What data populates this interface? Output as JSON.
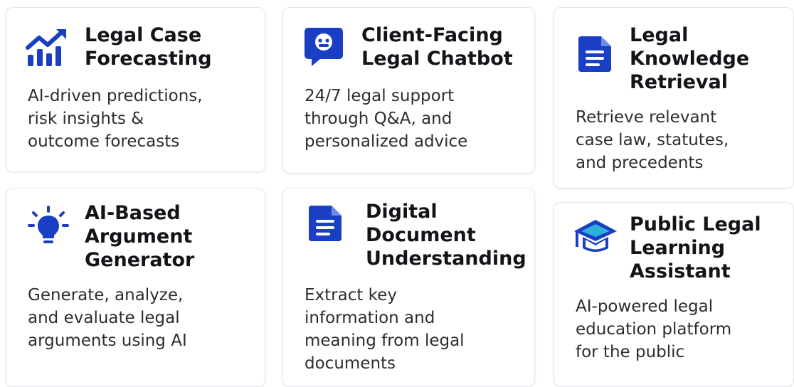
{
  "colors": {
    "accent": "#1a3fc4",
    "title": "#121418",
    "text": "#2b2d31",
    "border": "#e3e6eb"
  },
  "cards": [
    {
      "icon": "trend-chart-icon",
      "title_lines": [
        "Legal Case",
        "Forecasting"
      ],
      "desc_lines": [
        "AI-driven predictions,",
        "risk insights &",
        "outcome forecasts"
      ]
    },
    {
      "icon": "chatbot-icon",
      "title_lines": [
        "Client-Facing",
        "Legal Chatbot"
      ],
      "desc_lines": [
        "24/7 legal support",
        "through Q&A, and",
        "personalized advice"
      ]
    },
    {
      "icon": "document-icon",
      "title_lines": [
        "Legal",
        "Knowledge",
        "Retrieval"
      ],
      "desc_lines": [
        "Retrieve relevant",
        "case law, statutes,",
        "and precedents"
      ]
    },
    {
      "icon": "lightbulb-icon",
      "title_lines": [
        "AI-Based",
        "Argument",
        "Generator"
      ],
      "desc_lines": [
        "Generate, analyze,",
        "and evaluate legal",
        "arguments using AI"
      ]
    },
    {
      "icon": "document-icon",
      "title_lines": [
        "Digital",
        "Document",
        "Understanding"
      ],
      "desc_lines": [
        "Extract key",
        "information and",
        "meaning from legal",
        "documents"
      ]
    },
    {
      "icon": "graduation-cap-icon",
      "title_lines": [
        "Public Legal",
        "Learning",
        "Assistant"
      ],
      "desc_lines": [
        "AI-powered legal",
        "education platform",
        "for the public"
      ]
    }
  ]
}
